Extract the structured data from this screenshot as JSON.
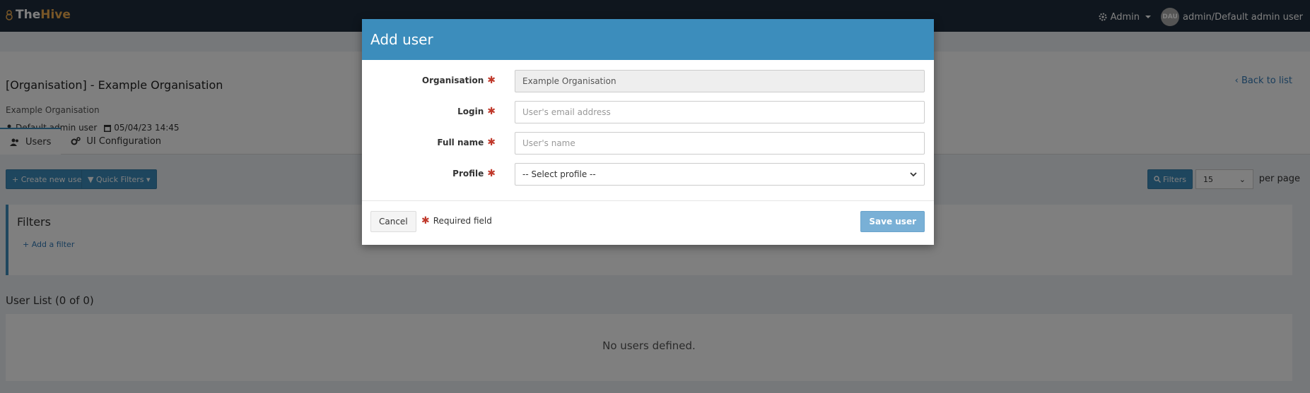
{
  "navbar": {
    "brand_the": "The",
    "brand_hive": "Hive",
    "admin_menu": "Admin",
    "avatar_initials": "DAU",
    "user_label": "admin/Default admin user"
  },
  "org": {
    "title": "[Organisation] - Example Organisation",
    "back_link": "Back to list",
    "name": "Example Organisation",
    "created_by": "Default admin user",
    "created_at": "05/04/23 14:45"
  },
  "tabs": [
    {
      "label": "Users",
      "icon": "users-icon"
    },
    {
      "label": "UI Configuration",
      "icon": "cogs-icon"
    }
  ],
  "toolbar": {
    "create_user": "Create new user",
    "quick_filters": "Quick Filters",
    "filters": "Filters",
    "per_page_value": "15",
    "per_page_label": "per page"
  },
  "filters_panel": {
    "title": "Filters",
    "add_filter": "Add a filter"
  },
  "user_list": {
    "title": "User List (0 of 0)",
    "empty": "No users defined."
  },
  "modal": {
    "title": "Add user",
    "fields": {
      "organisation": {
        "label": "Organisation",
        "value": "Example Organisation"
      },
      "login": {
        "label": "Login",
        "placeholder": "User's email address"
      },
      "full_name": {
        "label": "Full name",
        "placeholder": "User's name"
      },
      "profile": {
        "label": "Profile",
        "selected": "-- Select profile --"
      }
    },
    "cancel": "Cancel",
    "required_note": "Required field",
    "save": "Save user"
  },
  "colors": {
    "navbar_bg": "#1f2d3d",
    "brand_accent": "#f0ad4e",
    "primary": "#3c8dbc",
    "required": "#c0392b",
    "save_disabled": "#79b0d6"
  }
}
